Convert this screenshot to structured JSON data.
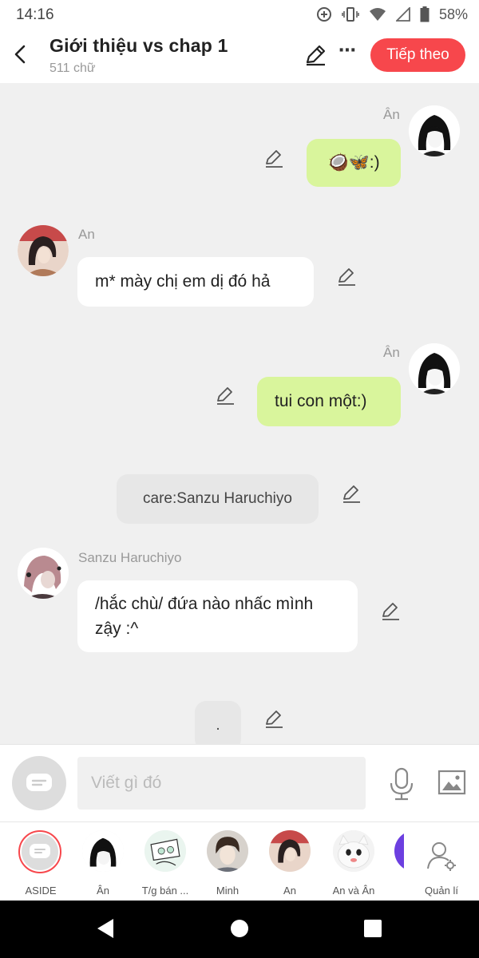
{
  "status_bar": {
    "time": "14:16",
    "battery": "58%"
  },
  "header": {
    "title": "Giới thiệu vs chap 1",
    "word_count": "511 chữ",
    "next_button": "Tiếp theo"
  },
  "messages": [
    {
      "sender": "Ân",
      "text": "🥥🦋:)",
      "side": "right"
    },
    {
      "sender": "An",
      "text": "m* mày chị em dị đó hả",
      "side": "left"
    },
    {
      "sender": "Ân",
      "text": "tui con một:)",
      "side": "right"
    },
    {
      "sender": "",
      "text": "care:Sanzu Haruchiyo",
      "side": "center"
    },
    {
      "sender": "Sanzu Haruchiyo",
      "text": "/hắc chù/ đứa nào nhấc mình zậy :^",
      "side": "left"
    },
    {
      "sender": "",
      "text": ".",
      "side": "center"
    }
  ],
  "input": {
    "placeholder": "Viết gì đó"
  },
  "characters": [
    {
      "label": "ASIDE"
    },
    {
      "label": "Ân"
    },
    {
      "label": "T/g bán ..."
    },
    {
      "label": "Minh"
    },
    {
      "label": "An"
    },
    {
      "label": "An và Ân"
    },
    {
      "label": "Quản lí"
    }
  ],
  "colors": {
    "accent": "#f7474c",
    "my_bubble": "#d9f59c",
    "other_bubble": "#ffffff",
    "background": "#f0f0f0"
  }
}
